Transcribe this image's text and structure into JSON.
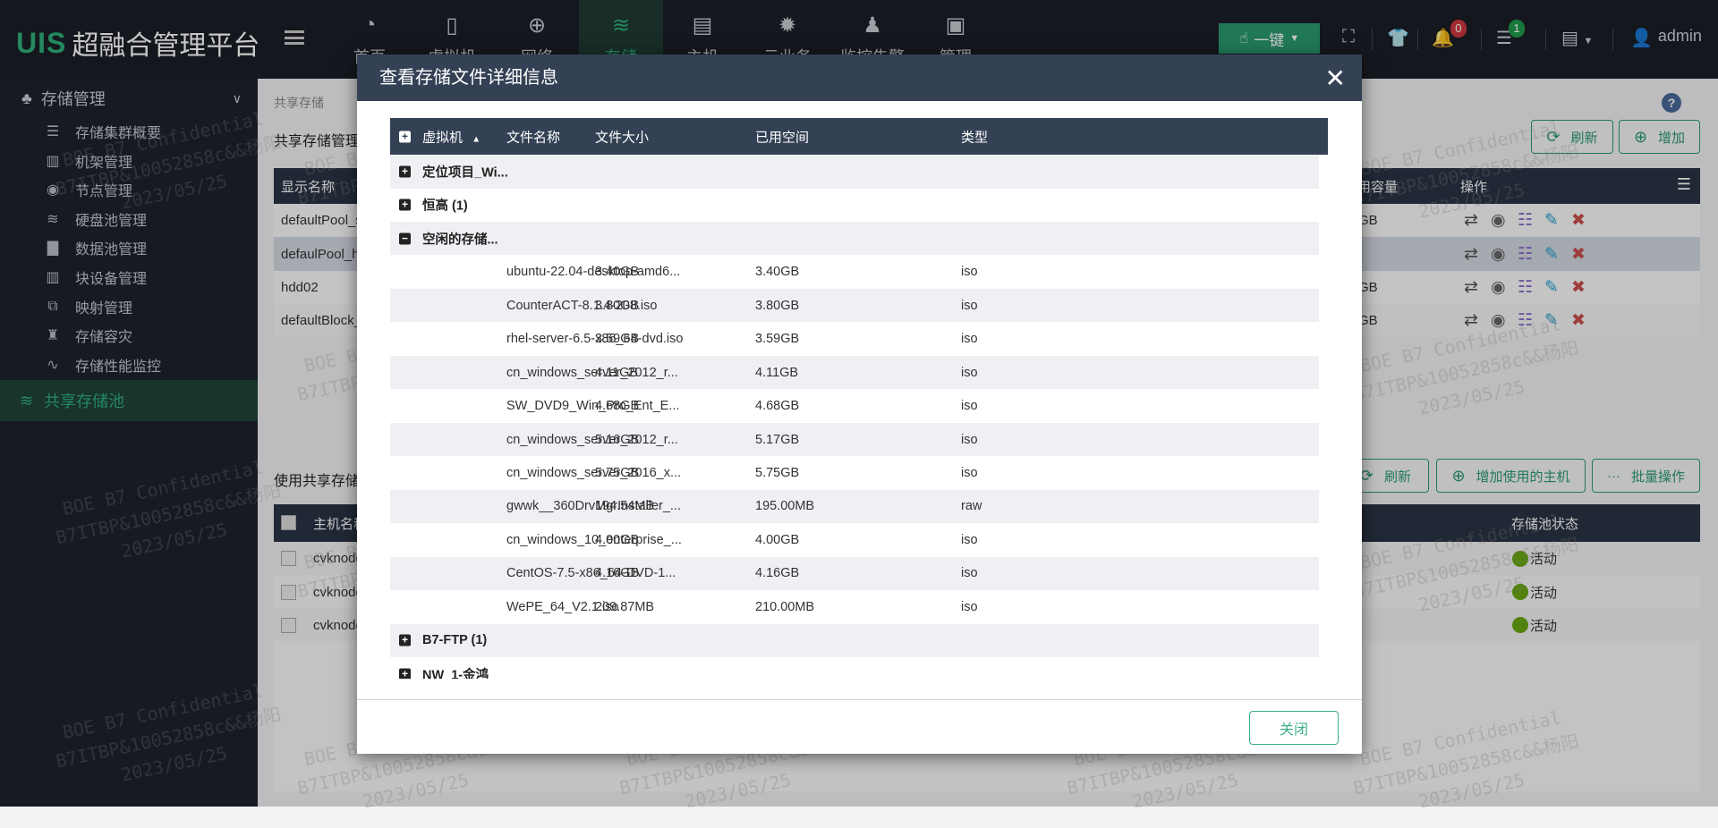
{
  "app": {
    "logo_mark": "UIS",
    "title": "超融合管理平台"
  },
  "nav": [
    {
      "label": "首页",
      "icon": "dashboard-icon"
    },
    {
      "label": "虚拟机",
      "icon": "vm-icon"
    },
    {
      "label": "网络",
      "icon": "globe-icon"
    },
    {
      "label": "存储",
      "icon": "database-icon",
      "active": true
    },
    {
      "label": "主机",
      "icon": "server-icon"
    },
    {
      "label": "云业务",
      "icon": "gear-icon"
    },
    {
      "label": "监控告警",
      "icon": "alarm-icon"
    },
    {
      "label": "管理",
      "icon": "monitor-icon"
    }
  ],
  "toolbar": {
    "one_click": "一键",
    "alerts_count": "0",
    "tasks_count": "1",
    "user": "admin"
  },
  "sidebar": {
    "section": "存储管理",
    "items": [
      "存储集群概要",
      "机架管理",
      "节点管理",
      "硬盘池管理",
      "数据池管理",
      "块设备管理",
      "映射管理",
      "存储容灾",
      "存储性能监控"
    ],
    "active": "共享存储池"
  },
  "main": {
    "breadcrumb": "共享存储",
    "section1_title": "共享存储管理",
    "refresh": "刷新",
    "add": "增加",
    "table1": {
      "headers": {
        "name": "显示名称",
        "capacity": "可用容量",
        "ops": "操作"
      },
      "rows": [
        {
          "name": "defaultPool_s",
          "capacity": "GB"
        },
        {
          "name": "defaulPool_h",
          "capacity": ""
        },
        {
          "name": "hdd02",
          "capacity": "GB"
        },
        {
          "name": "defaultBlock_",
          "capacity": "GB"
        }
      ]
    },
    "section2_title": "使用共享存储",
    "refresh2": "刷新",
    "add_host": "增加使用的主机",
    "batch": "批量操作",
    "table2": {
      "headers": {
        "host": "主机名称",
        "status": "存储池状态"
      },
      "rows": [
        {
          "host": "cvknode",
          "status": "活动"
        },
        {
          "host": "cvknode",
          "status": "活动"
        },
        {
          "host": "cvknode",
          "status": "活动"
        }
      ]
    }
  },
  "modal": {
    "title": "查看存储文件详细信息",
    "headers": {
      "vm": "虚拟机",
      "file": "文件名称",
      "size": "文件大小",
      "used": "已用空间",
      "type": "类型"
    },
    "groups_before": [
      {
        "name": "定位项目_Wi...",
        "expanded": false
      },
      {
        "name": "恒高 (1)",
        "expanded": false
      },
      {
        "name": "空闲的存储...",
        "expanded": true
      }
    ],
    "files": [
      {
        "file": "ubuntu-22.04-desktop-amd6...",
        "size": "3.40GB",
        "used": "3.40GB",
        "type": "iso"
      },
      {
        "file": "CounterACT-8.1.4-208.iso",
        "size": "3.80GB",
        "used": "3.80GB",
        "type": "iso"
      },
      {
        "file": "rhel-server-6.5-x86_64-dvd.iso",
        "size": "3.59GB",
        "used": "3.59GB",
        "type": "iso"
      },
      {
        "file": "cn_windows_server_2012_r...",
        "size": "4.11GB",
        "used": "4.11GB",
        "type": "iso"
      },
      {
        "file": "SW_DVD9_Win_Pro_Ent_E...",
        "size": "4.68GB",
        "used": "4.68GB",
        "type": "iso"
      },
      {
        "file": "cn_windows_server_2012_r...",
        "size": "5.16GB",
        "used": "5.17GB",
        "type": "iso"
      },
      {
        "file": "cn_windows_server_2016_x...",
        "size": "5.75GB",
        "used": "5.75GB",
        "type": "iso"
      },
      {
        "file": "gwwk__360DrvMgrInstaller_...",
        "size": "194.54MB",
        "used": "195.00MB",
        "type": "raw"
      },
      {
        "file": "cn_windows_10_enterprise_...",
        "size": "4.00GB",
        "used": "4.00GB",
        "type": "iso"
      },
      {
        "file": "CentOS-7.5-x86_64-DVD-1...",
        "size": "4.16GB",
        "used": "4.16GB",
        "type": "iso"
      },
      {
        "file": "WePE_64_V2.1.iso",
        "size": "209.87MB",
        "used": "210.00MB",
        "type": "iso"
      }
    ],
    "groups_after": [
      {
        "name": "B7-FTP (1)",
        "expanded": false
      },
      {
        "name": "NW_1-金鸿",
        "expanded": false
      }
    ],
    "close": "关闭"
  },
  "watermark": {
    "line1": "BOE B7 Confidential",
    "line2": "B7ITBP&10052858c&&杨阳",
    "line3": "2023/05/25"
  },
  "colors": {
    "accent": "#2a9a70",
    "header": "#344155",
    "status_active": "#6aa812",
    "delete": "#c9504e",
    "edit": "#2aa0d0"
  }
}
